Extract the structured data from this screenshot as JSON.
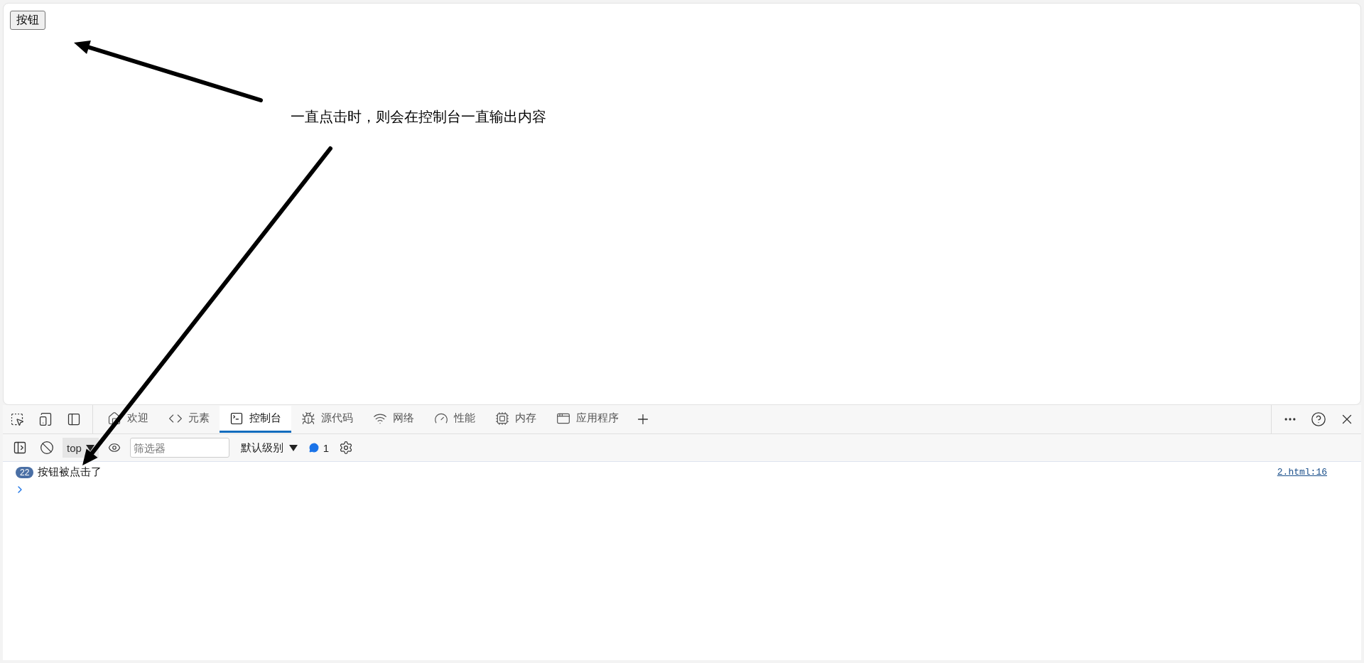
{
  "page": {
    "button": "按钮",
    "annotation": "一直点击时，则会在控制台一直输出内容"
  },
  "devtools": {
    "tabs": [
      {
        "label": "欢迎",
        "selected": false
      },
      {
        "label": "元素",
        "selected": false
      },
      {
        "label": "控制台",
        "selected": true
      },
      {
        "label": "源代码",
        "selected": false
      },
      {
        "label": "网络",
        "selected": false
      },
      {
        "label": "性能",
        "selected": false
      },
      {
        "label": "内存",
        "selected": false
      },
      {
        "label": "应用程序",
        "selected": false
      }
    ],
    "toolbar": {
      "context": "top",
      "filter": {
        "placeholder": "筛选器"
      },
      "level": "默认级别",
      "message_count": "1"
    },
    "messages": [
      {
        "count": "22",
        "text": "按钮被点击了",
        "source": "2.html:16"
      }
    ]
  }
}
